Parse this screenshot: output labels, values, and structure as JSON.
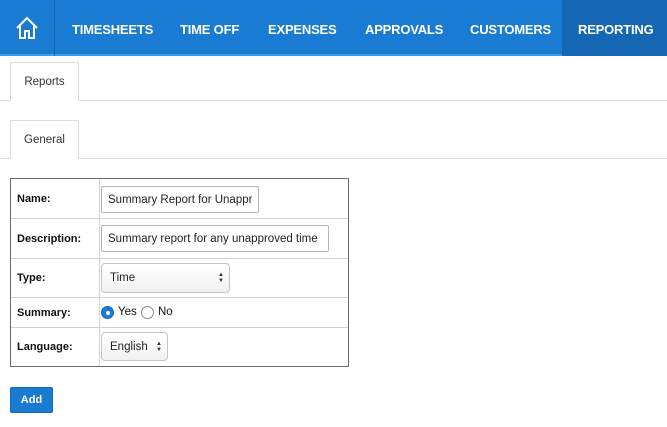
{
  "nav": {
    "items": [
      "TIMESHEETS",
      "TIME OFF",
      "EXPENSES",
      "APPROVALS",
      "CUSTOMERS",
      "REPORTING"
    ],
    "active": "REPORTING",
    "home_icon": "house-icon"
  },
  "tabs": {
    "primary": "Reports",
    "secondary": "General"
  },
  "form": {
    "name_label": "Name:",
    "name_value": "Summary Report for Unapproved Time",
    "description_label": "Description:",
    "description_value": "Summary report for any unapproved time",
    "type_label": "Type:",
    "type_value": "Time",
    "summary_label": "Summary:",
    "summary_yes": "Yes",
    "summary_no": "No",
    "summary_selected": "Yes",
    "language_label": "Language:",
    "language_value": "English"
  },
  "actions": {
    "add_label": "Add"
  },
  "colors": {
    "accent": "#1a7bd3",
    "nav_active": "#1567b3"
  }
}
